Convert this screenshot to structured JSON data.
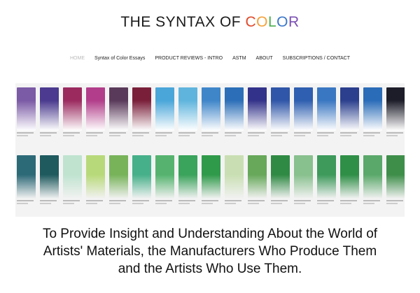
{
  "site": {
    "title_prefix": "THE SYNTAX OF ",
    "title_color_letters": [
      {
        "ch": "C",
        "color": "#e04a2b"
      },
      {
        "ch": "O",
        "color": "#f2a23a"
      },
      {
        "ch": "L",
        "color": "#4caf50"
      },
      {
        "ch": "O",
        "color": "#3a78c9"
      },
      {
        "ch": "R",
        "color": "#7b4fb3"
      }
    ]
  },
  "nav": {
    "items": [
      {
        "label": "HOME",
        "active": true
      },
      {
        "label": "Syntax of Color Essays",
        "active": false
      },
      {
        "label": "PRODUCT REVIEWS - INTRO",
        "active": false
      },
      {
        "label": "ASTM",
        "active": false
      },
      {
        "label": "ABOUT",
        "active": false
      },
      {
        "label": "SUBSCRIPTIONS / CONTACT",
        "active": false
      }
    ]
  },
  "banner": {
    "top_row_colors": [
      "#7b5aa6",
      "#4b3a8f",
      "#9b2a5f",
      "#b23d8a",
      "#5a3a5a",
      "#7a1f3a",
      "#4aa6d9",
      "#5fb4dd",
      "#3f86c9",
      "#2c6fb8",
      "#33328a",
      "#2f56a8",
      "#2e5fb0",
      "#3a77c2",
      "#2b3f8e",
      "#2a6cb8",
      "#1d1d2a"
    ],
    "bottom_row_colors": [
      "#2d6a78",
      "#1f5a5f",
      "#bfe3cf",
      "#b8d97a",
      "#78b35a",
      "#46b08a",
      "#55b36f",
      "#3aa35c",
      "#2f9a4a",
      "#c9dfb3",
      "#67a85a",
      "#2f8a44",
      "#88c08e",
      "#3d9a5b",
      "#2f8f47",
      "#5aa86a",
      "#3e8e4a"
    ]
  },
  "mission": {
    "lines": [
      "To Provide Insight and Understanding About the World of",
      "Artists' Materials, the Manufacturers Who Produce Them",
      "and the Artists Who Use Them."
    ]
  }
}
